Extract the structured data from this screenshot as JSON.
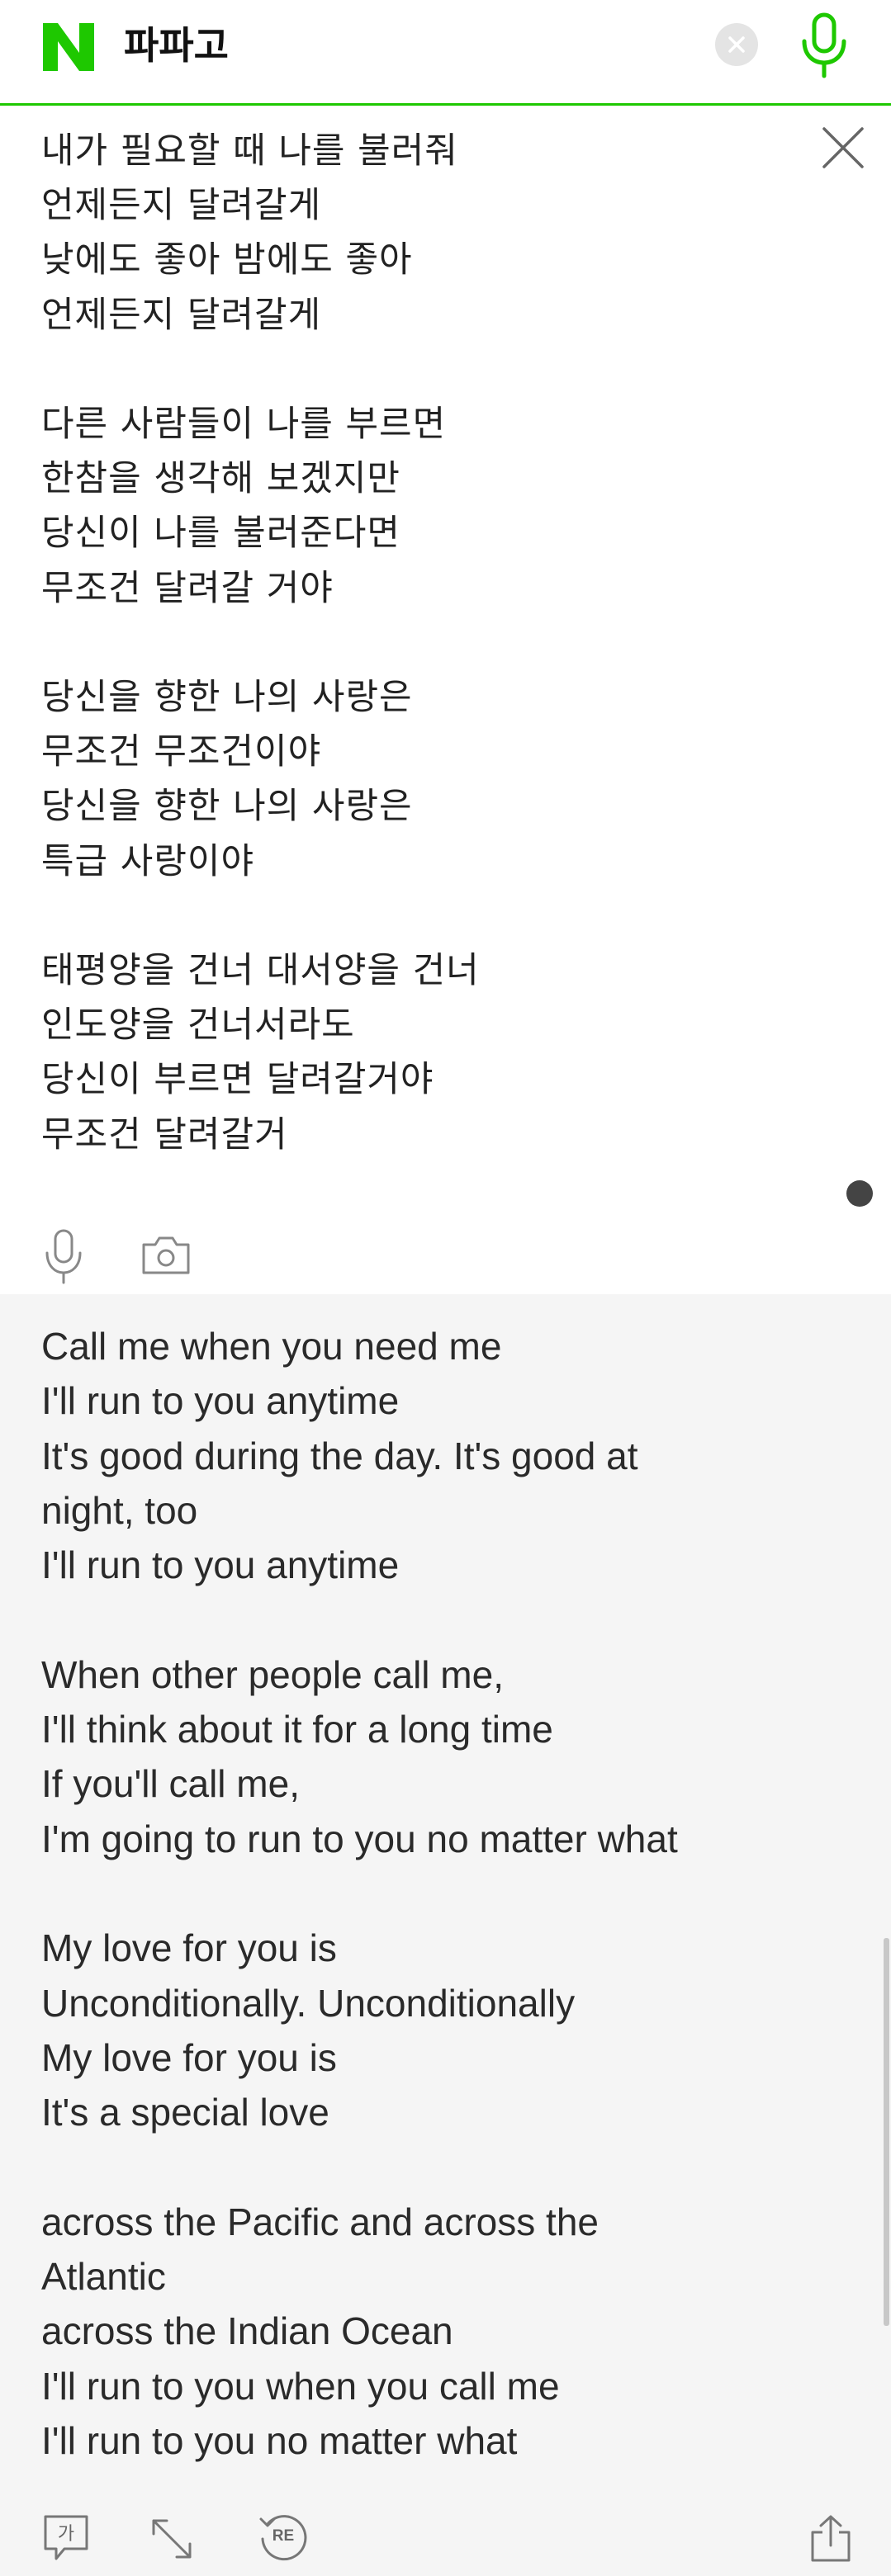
{
  "header": {
    "logo_letter": "N",
    "title": "파파고",
    "brand_color": "#1ec800",
    "clear_icon": "clear-circle-icon",
    "mic_icon": "microphone-icon"
  },
  "source": {
    "lyrics": "내가 필요할 때 나를 불러줘\n언제든지 달려갈게\n낮에도 좋아 밤에도 좋아\n언제든지 달려갈게\n\n다른 사람들이 나를 부르면\n한참을 생각해 보겠지만\n당신이 나를 불러준다면\n무조건 달려갈 거야\n\n당신을 향한 나의 사랑은\n무조건 무조건이야\n당신을 향한 나의 사랑은\n특급 사랑이야\n\n태평양을 건너 대서양을 건너\n인도양을 건너서라도\n당신이 부르면 달려갈거야\n무조건 달려갈거",
    "tools": [
      "microphone-icon",
      "camera-icon"
    ]
  },
  "target": {
    "lyrics": "Call me when you need me\nI'll run to you anytime\nIt's good during the day. It's good at\nnight, too\nI'll run to you anytime\n\nWhen other people call me,\nI'll think about it for a long time\nIf you'll call me,\nI'm going to run to you no matter what\n\nMy love for you is\nUnconditionally. Unconditionally\nMy love for you is\nIt's a special love\n\nacross the Pacific and across the\nAtlantic\nacross the Indian Ocean\nI'll run to you when you call me\nI'll run to you no matter what",
    "tools": {
      "honorific_label": "가",
      "replay_label": "RE"
    }
  }
}
